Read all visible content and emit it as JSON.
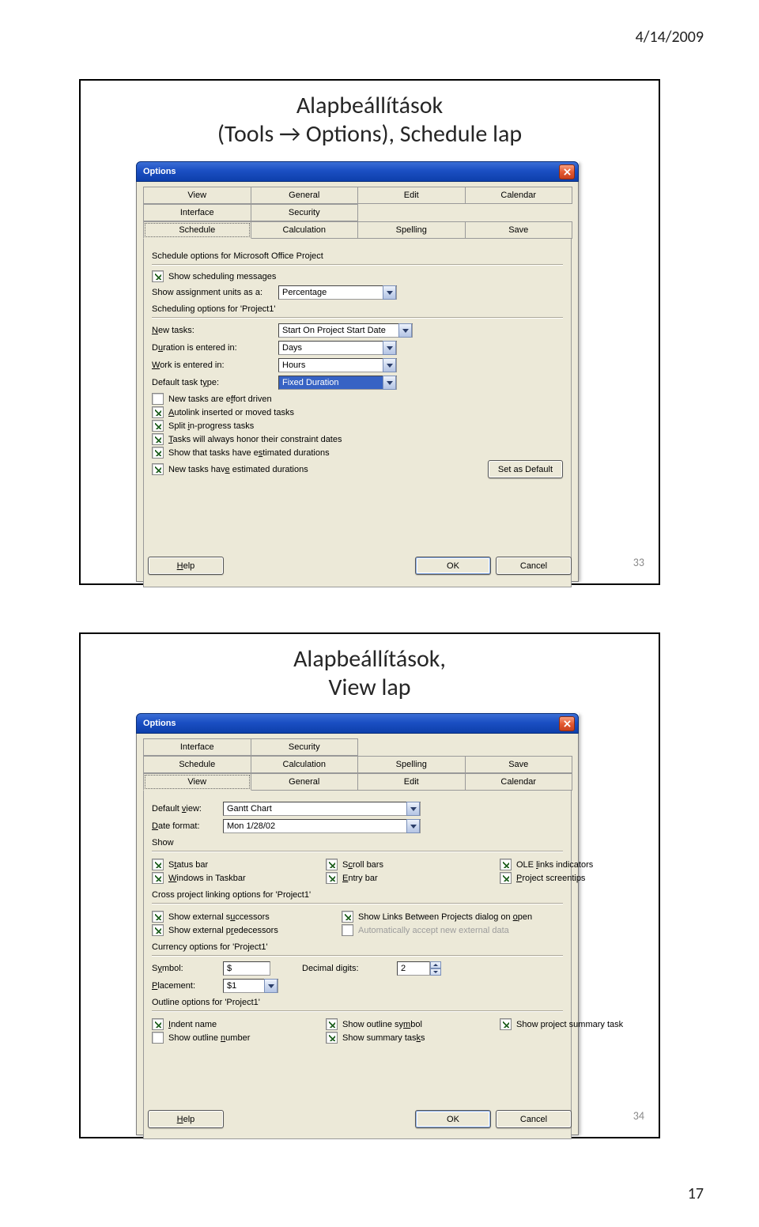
{
  "page": {
    "date": "4/14/2009",
    "number": "17"
  },
  "slide1": {
    "title_line1": "Alapbeállítások",
    "title_line2": "(Tools → Options), Schedule lap",
    "number": "33",
    "dialog": {
      "title": "Options",
      "tabs_row1": [
        "View",
        "General",
        "Edit",
        "Calendar"
      ],
      "tabs_row2": [
        "Interface",
        "Security",
        "",
        ""
      ],
      "tabs_row3": [
        "Schedule",
        "Calculation",
        "Spelling",
        "Save"
      ],
      "selected_tab": "Schedule",
      "section_sched_opts": "Schedule options for Microsoft Office Project",
      "show_messages": "Show scheduling messages",
      "show_units_lbl": "Show assignment units as a:",
      "show_units_val": "Percentage",
      "section_sched_for": "Scheduling options for 'Project1'",
      "new_tasks_lbl": "New tasks:",
      "new_tasks_val": "Start On Project Start Date",
      "duration_lbl": "Duration is entered in:",
      "duration_val": "Days",
      "work_lbl": "Work is entered in:",
      "work_val": "Hours",
      "deftype_lbl": "Default task type:",
      "deftype_val": "Fixed Duration",
      "cb_effort": "New tasks are effort driven",
      "cb_autolink": "Autolink inserted or moved tasks",
      "cb_split": "Split in-progress tasks",
      "cb_honor": "Tasks will always honor their constraint dates",
      "cb_showest": "Show that tasks have estimated durations",
      "cb_newest": "New tasks have estimated durations",
      "btn_default": "Set as Default",
      "btn_help": "Help",
      "btn_ok": "OK",
      "btn_cancel": "Cancel"
    }
  },
  "slide2": {
    "title_line1": "Alapbeállítások,",
    "title_line2": "View lap",
    "number": "34",
    "dialog": {
      "title": "Options",
      "tabs_row1": [
        "Interface",
        "Security",
        "",
        ""
      ],
      "tabs_row2": [
        "Schedule",
        "Calculation",
        "Spelling",
        "Save"
      ],
      "tabs_row3": [
        "View",
        "General",
        "Edit",
        "Calendar"
      ],
      "selected_tab": "View",
      "default_view_lbl": "Default view:",
      "default_view_val": "Gantt Chart",
      "date_format_lbl": "Date format:",
      "date_format_val": "Mon 1/28/02",
      "section_show": "Show",
      "cb_status": "Status bar",
      "cb_scroll": "Scroll bars",
      "cb_ole": "OLE links indicators",
      "cb_winintask": "Windows in Taskbar",
      "cb_entry": "Entry bar",
      "cb_screentips": "Project screentips",
      "section_cross": "Cross project linking options for 'Project1'",
      "cb_ext_succ": "Show external successors",
      "cb_show_links": "Show Links Between Projects dialog on open",
      "cb_ext_pred": "Show external predecessors",
      "cb_auto_accept": "Automatically accept new external data",
      "section_currency": "Currency options for 'Project1'",
      "symbol_lbl": "Symbol:",
      "symbol_val": "$",
      "decimal_lbl": "Decimal digits:",
      "decimal_val": "2",
      "placement_lbl": "Placement:",
      "placement_val": "$1",
      "section_outline": "Outline options for 'Project1'",
      "cb_indent": "Indent name",
      "cb_outsym": "Show outline symbol",
      "cb_projsum": "Show project summary task",
      "cb_outnum": "Show outline number",
      "cb_summary": "Show summary tasks",
      "btn_help": "Help",
      "btn_ok": "OK",
      "btn_cancel": "Cancel"
    }
  }
}
